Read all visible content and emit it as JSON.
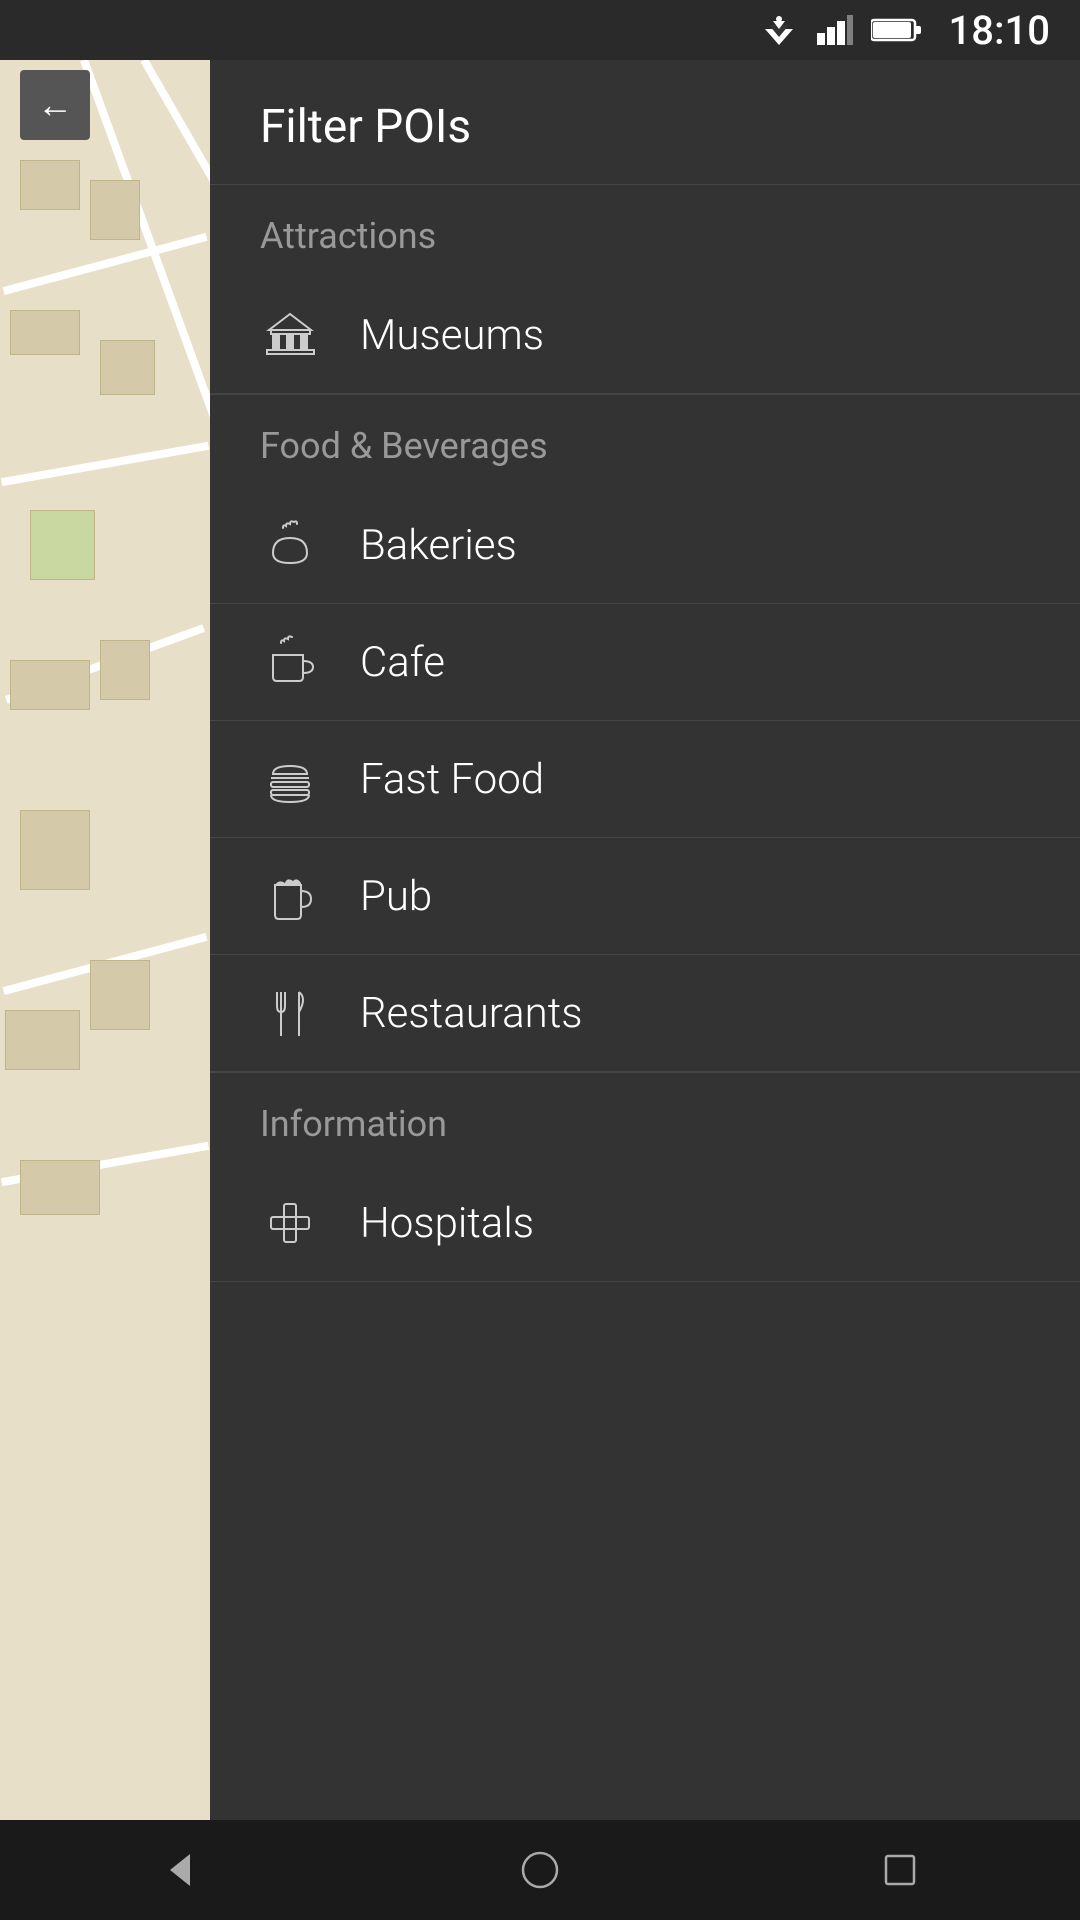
{
  "statusBar": {
    "time": "18:10"
  },
  "backButton": {
    "label": "←"
  },
  "panel": {
    "title": "Filter POIs",
    "sections": [
      {
        "name": "Attractions",
        "items": [
          {
            "id": "museums",
            "label": "Museums",
            "icon": "museum"
          }
        ]
      },
      {
        "name": "Food & Beverages",
        "items": [
          {
            "id": "bakeries",
            "label": "Bakeries",
            "icon": "bakery"
          },
          {
            "id": "cafe",
            "label": "Cafe",
            "icon": "cafe"
          },
          {
            "id": "fast-food",
            "label": "Fast Food",
            "icon": "fastfood"
          },
          {
            "id": "pub",
            "label": "Pub",
            "icon": "pub"
          },
          {
            "id": "restaurants",
            "label": "Restaurants",
            "icon": "restaurant"
          }
        ]
      },
      {
        "name": "Information",
        "items": [
          {
            "id": "hospitals",
            "label": "Hospitals",
            "icon": "hospital"
          }
        ]
      }
    ]
  },
  "bottomNav": {
    "back": "◁",
    "home": "○",
    "recent": "□"
  }
}
